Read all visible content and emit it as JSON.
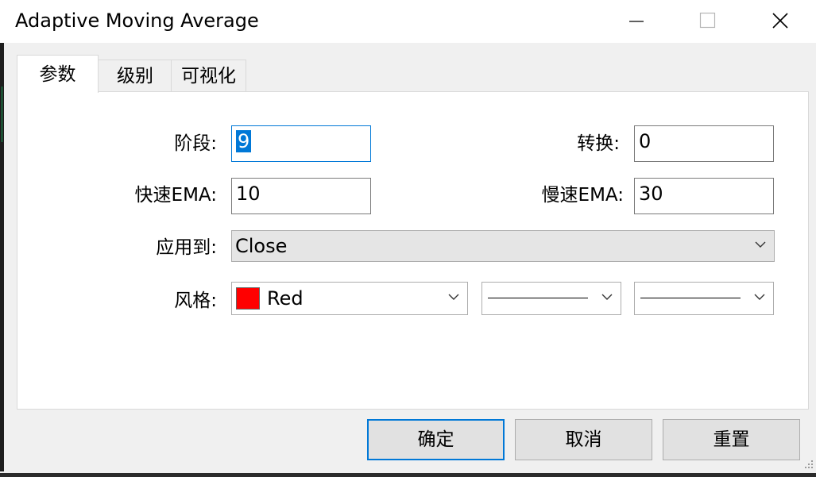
{
  "window": {
    "title": "Adaptive Moving Average",
    "controls": [
      "minimize-icon",
      "maximize-icon",
      "close-icon"
    ]
  },
  "tabs": [
    {
      "label": "参数",
      "active": true
    },
    {
      "label": "级别",
      "active": false
    },
    {
      "label": "可视化",
      "active": false
    }
  ],
  "params": {
    "period": {
      "label": "阶段:",
      "value": "9"
    },
    "shift": {
      "label": "转换:",
      "value": "0"
    },
    "fast_ema": {
      "label": "快速EMA:",
      "value": "10"
    },
    "slow_ema": {
      "label": "慢速EMA:",
      "value": "30"
    },
    "apply_to": {
      "label": "应用到:",
      "value": "Close"
    },
    "style": {
      "label": "风格:",
      "color_name": "Red",
      "color_hex": "#ff0000"
    }
  },
  "buttons": {
    "ok": "确定",
    "cancel": "取消",
    "reset": "重置"
  },
  "colors": {
    "accent": "#0078d7",
    "window_bg": "#f0f0f0",
    "panel_bg": "#ffffff"
  }
}
